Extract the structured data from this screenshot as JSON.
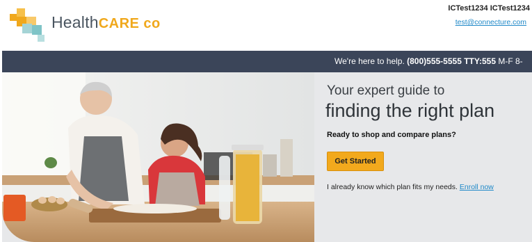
{
  "brand": {
    "name_part1": "Health",
    "name_part2": "CARE co",
    "colors": {
      "orange": "#f0a81c",
      "teal": "#7fc4c7",
      "gray_text": "#4a5560"
    }
  },
  "account": {
    "user_name": "ICTest1234 ICTest1234",
    "email": "test@connecture.com"
  },
  "helpbar": {
    "lead": "We're here to help.",
    "phone": "(800)555-5555 TTY:555",
    "hours": "M-F 8-"
  },
  "hero": {
    "title_line1": "Your expert guide to",
    "title_line2": "finding the right plan",
    "question": "Ready to shop and compare plans?",
    "cta_label": "Get Started",
    "enroll_text": "I already know which plan fits my needs.",
    "enroll_link": "Enroll now",
    "photo_subject": "grandmother-and-girl-baking-photo"
  }
}
